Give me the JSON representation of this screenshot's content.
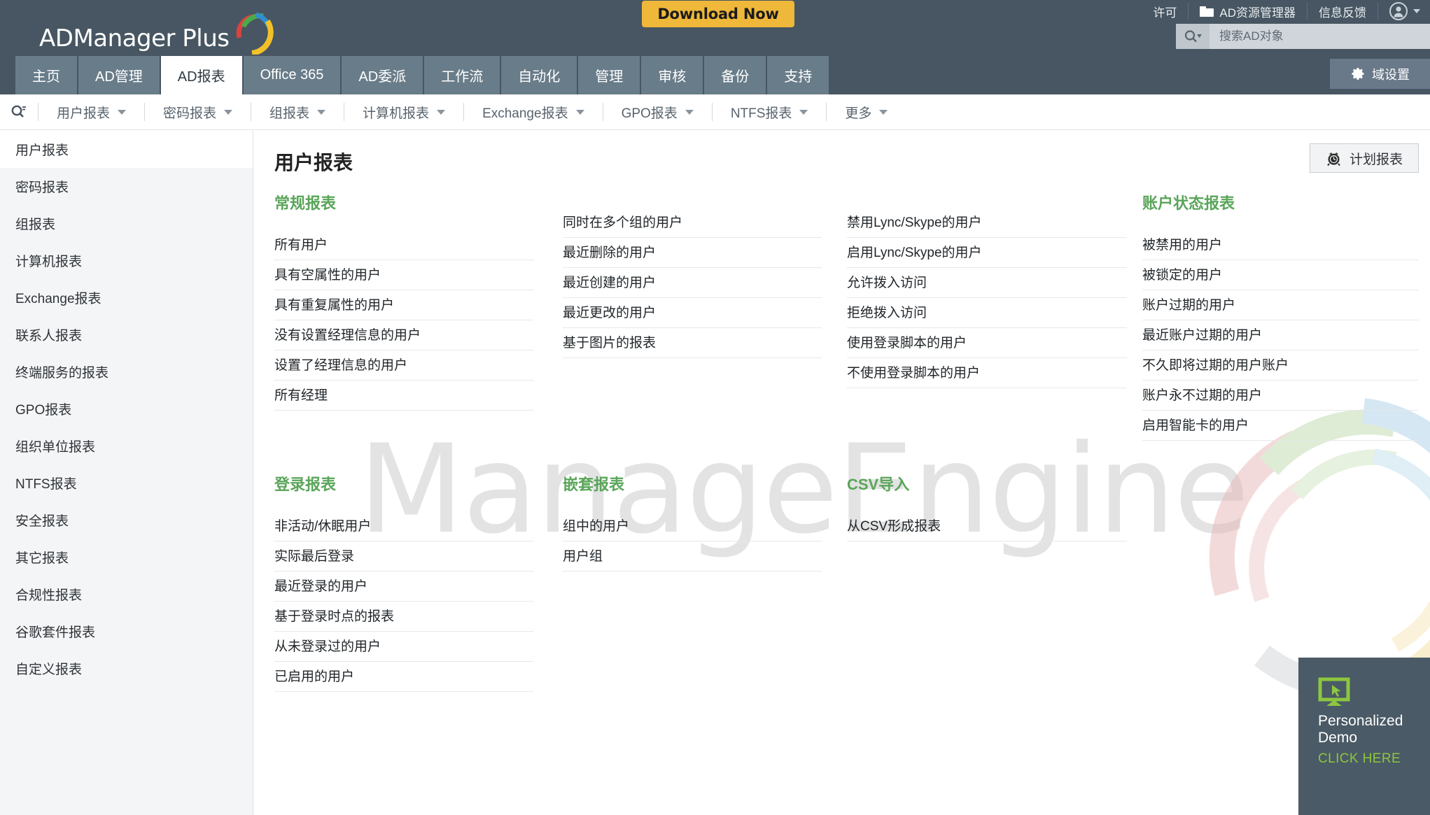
{
  "app": {
    "logo_text": "ADManager Plus",
    "download_label": "Download Now"
  },
  "top_right": {
    "license": "许可",
    "ad_explorer": "AD资源管理器",
    "feedback": "信息反馈"
  },
  "search": {
    "placeholder": "搜索AD对象",
    "value": ""
  },
  "tabs": [
    {
      "label": "主页",
      "active": false
    },
    {
      "label": "AD管理",
      "active": false
    },
    {
      "label": "AD报表",
      "active": true
    },
    {
      "label": "Office 365",
      "active": false
    },
    {
      "label": "AD委派",
      "active": false
    },
    {
      "label": "工作流",
      "active": false
    },
    {
      "label": "自动化",
      "active": false
    },
    {
      "label": "管理",
      "active": false
    },
    {
      "label": "审核",
      "active": false
    },
    {
      "label": "备份",
      "active": false
    },
    {
      "label": "支持",
      "active": false
    }
  ],
  "domain_settings": {
    "label": "域设置"
  },
  "subnav": [
    {
      "label": "用户报表"
    },
    {
      "label": "密码报表"
    },
    {
      "label": "组报表"
    },
    {
      "label": "计算机报表"
    },
    {
      "label": "Exchange报表"
    },
    {
      "label": "GPO报表"
    },
    {
      "label": "NTFS报表"
    },
    {
      "label": "更多"
    }
  ],
  "sidebar": {
    "items": [
      {
        "label": "用户报表",
        "active": true
      },
      {
        "label": "密码报表",
        "active": false
      },
      {
        "label": "组报表",
        "active": false
      },
      {
        "label": "计算机报表",
        "active": false
      },
      {
        "label": "Exchange报表",
        "active": false
      },
      {
        "label": "联系人报表",
        "active": false
      },
      {
        "label": "终端服务的报表",
        "active": false
      },
      {
        "label": "GPO报表",
        "active": false
      },
      {
        "label": "组织单位报表",
        "active": false
      },
      {
        "label": "NTFS报表",
        "active": false
      },
      {
        "label": "安全报表",
        "active": false
      },
      {
        "label": "其它报表",
        "active": false
      },
      {
        "label": "合规性报表",
        "active": false
      },
      {
        "label": "谷歌套件报表",
        "active": false
      },
      {
        "label": "自定义报表",
        "active": false
      }
    ]
  },
  "main": {
    "title": "用户报表",
    "schedule_button": "计划报表",
    "sections": [
      {
        "title": "常规报表",
        "items": [
          "所有用户",
          "具有空属性的用户",
          "具有重复属性的用户",
          "没有设置经理信息的用户",
          "设置了经理信息的用户",
          "所有经理"
        ]
      },
      {
        "title": "",
        "items": [
          "同时在多个组的用户",
          "最近删除的用户",
          "最近创建的用户",
          "最近更改的用户",
          "基于图片的报表"
        ]
      },
      {
        "title": "",
        "items": [
          "禁用Lync/Skype的用户",
          "启用Lync/Skype的用户",
          "允许拨入访问",
          "拒绝拨入访问",
          "使用登录脚本的用户",
          "不使用登录脚本的用户"
        ]
      },
      {
        "title": "账户状态报表",
        "items": [
          "被禁用的用户",
          "被锁定的用户",
          "账户过期的用户",
          "最近账户过期的用户",
          "不久即将过期的用户账户",
          "账户永不过期的用户",
          "启用智能卡的用户"
        ]
      },
      {
        "title": "登录报表",
        "items": [
          "非活动/休眠用户",
          "实际最后登录",
          "最近登录的用户",
          "基于登录时点的报表",
          "从未登录过的用户",
          "已启用的用户"
        ]
      },
      {
        "title": "嵌套报表",
        "items": [
          "组中的用户",
          "用户组"
        ]
      },
      {
        "title": "CSV导入",
        "items": [
          "从CSV形成报表"
        ]
      }
    ]
  },
  "watermark": {
    "text": "ManageEngine"
  },
  "promo": {
    "title_line1": "Personalized",
    "title_line2": "Demo",
    "cta": "CLICK HERE"
  },
  "colors": {
    "header": "#475662",
    "tab_inactive": "#697c89",
    "accent_green": "#5aa55a",
    "download_yellow": "#efb83a",
    "promo_green": "#8dc63f"
  }
}
